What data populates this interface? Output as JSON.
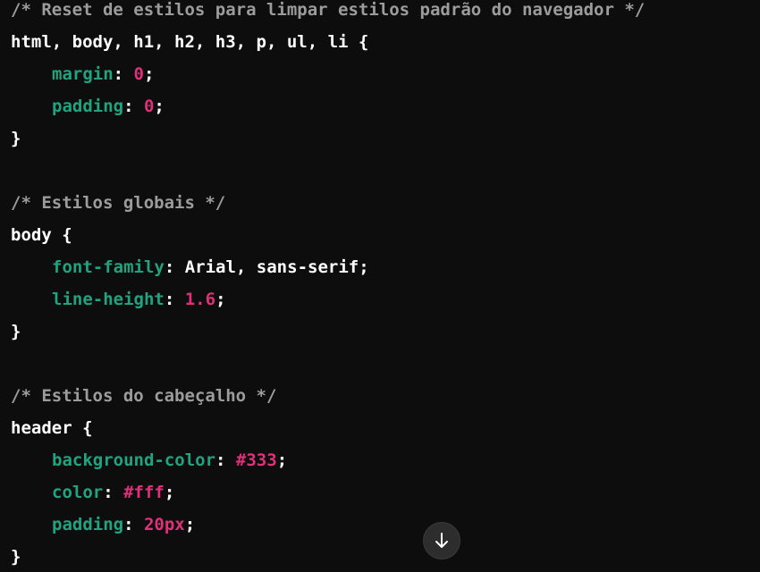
{
  "code": {
    "lines": [
      {
        "comment": "/* Reset de estilos para limpar estilos padrão do navegador */"
      },
      {
        "selector": "html, body, h1, h2, h3, p, ul, li {"
      },
      {
        "prop": "margin",
        "value": "0",
        "value_kind": "number"
      },
      {
        "prop": "padding",
        "value": "0",
        "value_kind": "number"
      },
      {
        "brace": "}"
      },
      {
        "blank": ""
      },
      {
        "comment": "/* Estilos globais */"
      },
      {
        "selector": "body {"
      },
      {
        "prop": "font-family",
        "value": "Arial, sans-serif",
        "value_kind": "plain"
      },
      {
        "prop": "line-height",
        "value": "1.6",
        "value_kind": "number"
      },
      {
        "brace": "}"
      },
      {
        "blank": ""
      },
      {
        "comment": "/* Estilos do cabeçalho */"
      },
      {
        "selector": "header {"
      },
      {
        "prop": "background-color",
        "value": "#333",
        "value_kind": "number"
      },
      {
        "prop": "color",
        "value": "#fff",
        "value_kind": "number"
      },
      {
        "prop": "padding",
        "value": "20px",
        "value_kind": "number"
      },
      {
        "brace": "}"
      }
    ]
  },
  "colors": {
    "background": "#0d0d0d",
    "comment": "#9c9c9c",
    "property": "#20a37f",
    "value_number": "#df3079",
    "text": "#ffffff"
  },
  "icons": {
    "scroll_down": "arrow-down-icon"
  }
}
